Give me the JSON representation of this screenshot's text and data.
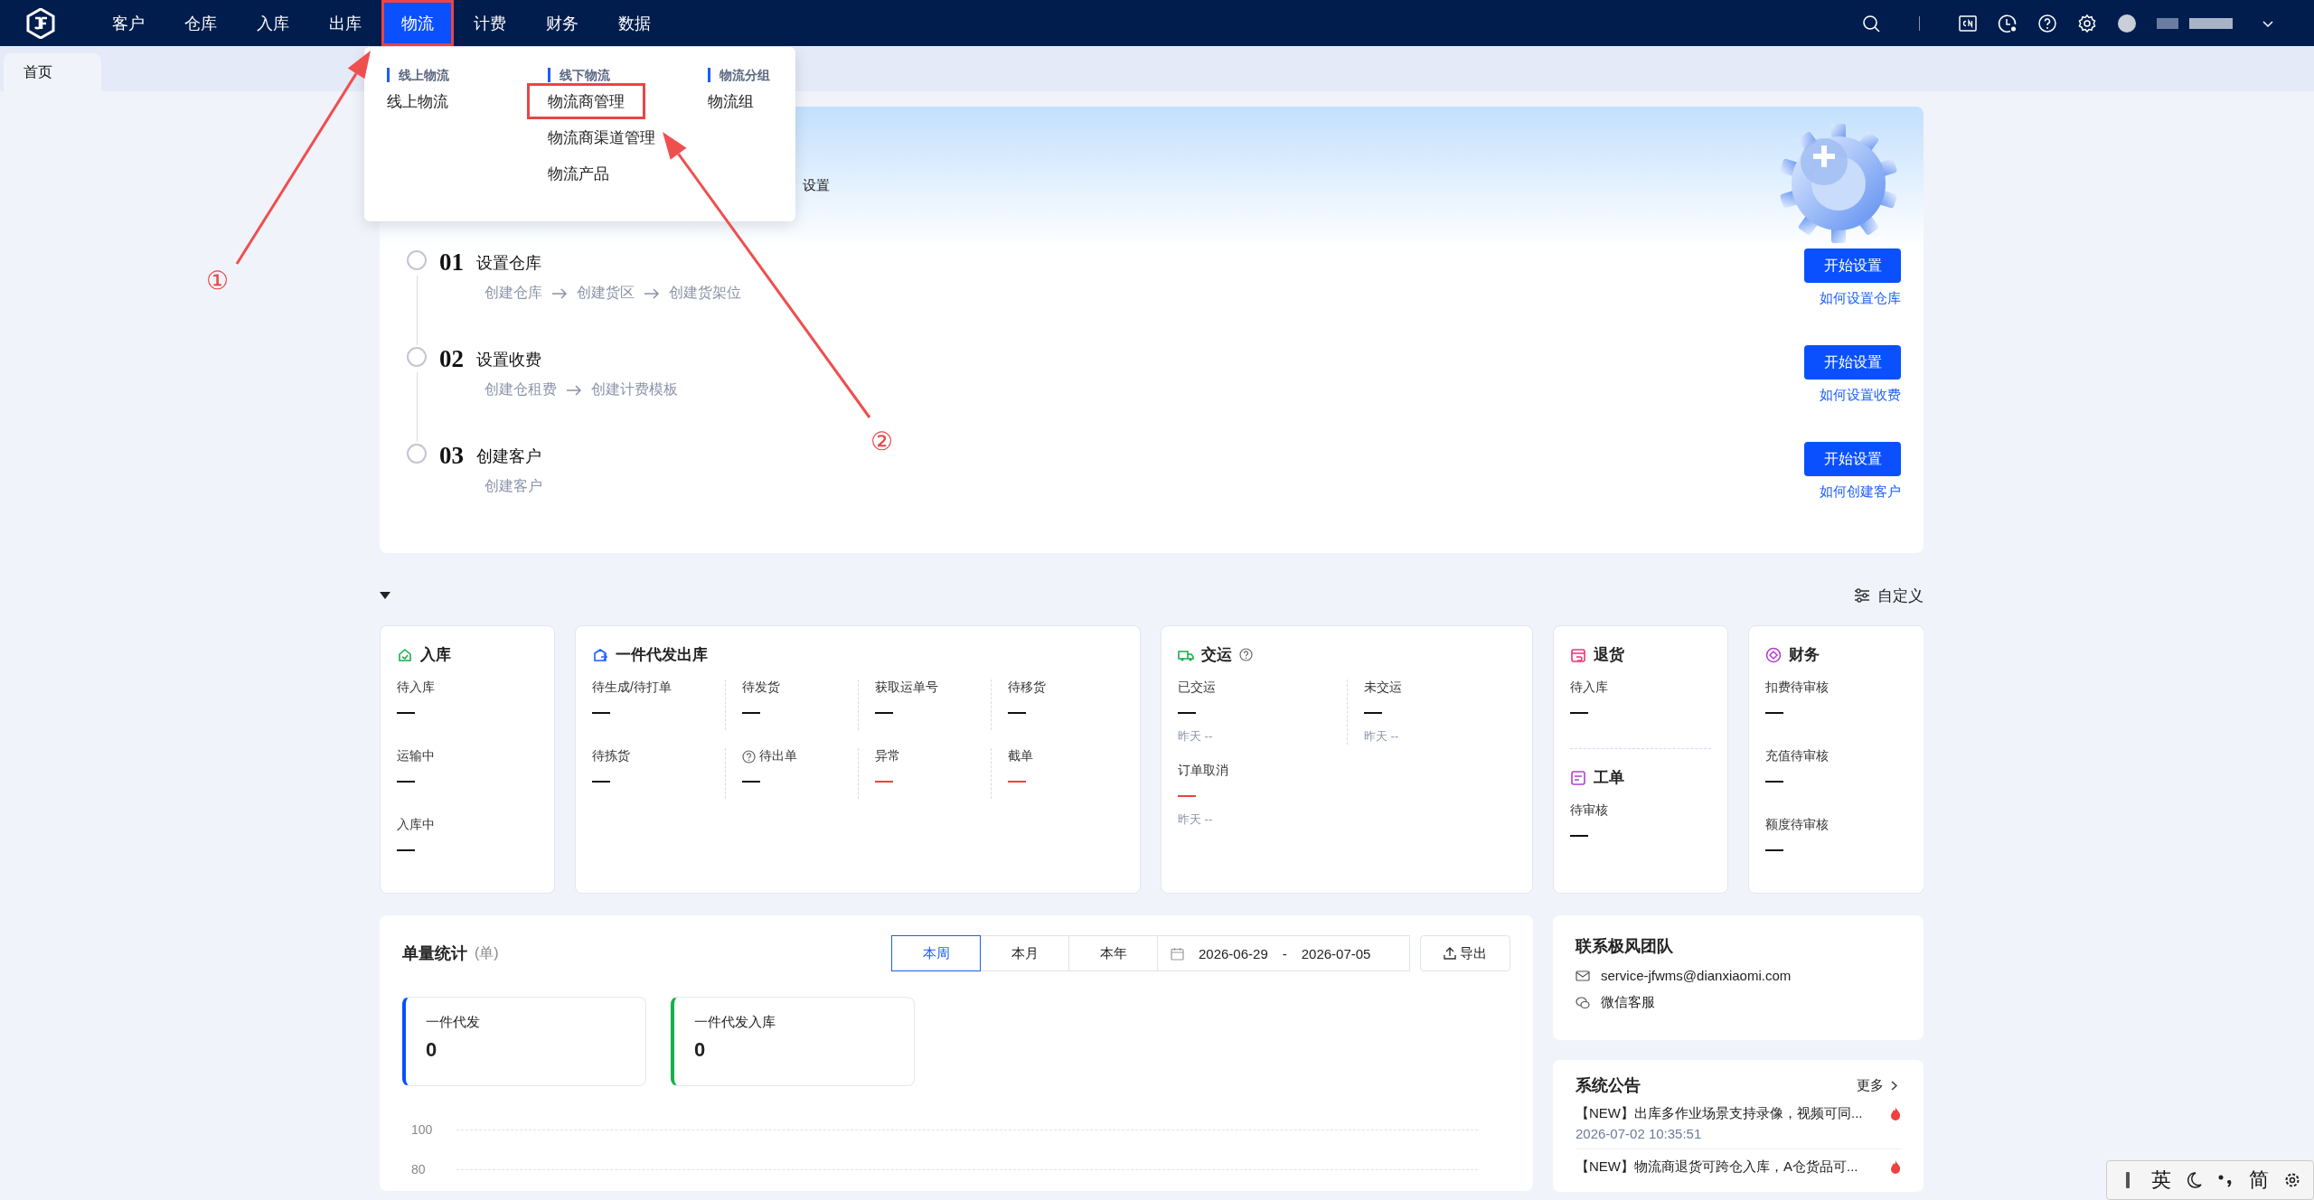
{
  "nav": {
    "items": [
      {
        "label": "客户",
        "selected": false,
        "annotated": false
      },
      {
        "label": "仓库",
        "selected": false,
        "annotated": false
      },
      {
        "label": "入库",
        "selected": false,
        "annotated": false
      },
      {
        "label": "出库",
        "selected": false,
        "annotated": false
      },
      {
        "label": "物流",
        "selected": true,
        "annotated": true
      },
      {
        "label": "计费",
        "selected": false,
        "annotated": false
      },
      {
        "label": "财务",
        "selected": false,
        "annotated": false
      },
      {
        "label": "数据",
        "selected": false,
        "annotated": false
      }
    ]
  },
  "tabs": [
    {
      "label": "首页",
      "selected": true
    }
  ],
  "menu": {
    "groups": [
      {
        "title": "线上物流",
        "items": [
          {
            "label": "线上物流",
            "annotated": false
          }
        ]
      },
      {
        "title": "线下物流",
        "items": [
          {
            "label": "物流商管理",
            "annotated": true
          },
          {
            "label": "物流商渠道管理",
            "annotated": false
          },
          {
            "label": "物流产品",
            "annotated": false
          }
        ]
      },
      {
        "title": "物流分组",
        "items": [
          {
            "label": "物流组",
            "annotated": false
          }
        ]
      }
    ]
  },
  "annotations": [
    {
      "label": "①"
    },
    {
      "label": "②"
    }
  ],
  "setup": {
    "title_fragment": "设置",
    "steps": [
      {
        "number": "01",
        "done": false,
        "title": "设置仓库",
        "substeps": [
          "创建仓库",
          "创建货区",
          "创建货架位"
        ],
        "button": "开始设置",
        "help_link": "如何设置仓库"
      },
      {
        "number": "02",
        "done": false,
        "title": "设置收费",
        "substeps": [
          "创建仓租费",
          "创建计费模板"
        ],
        "button": "开始设置",
        "help_link": "如何设置收费"
      },
      {
        "number": "03",
        "done": false,
        "title": "创建客户",
        "substeps": [
          "创建客户"
        ],
        "button": "开始设置",
        "help_link": "如何创建客户"
      }
    ]
  },
  "overview": {
    "expanded": true,
    "customize": "自定义",
    "cards": [
      {
        "sections": [
          {
            "kind": "inbound",
            "title": "入库",
            "help": false,
            "metrics": [
              {
                "label": "待入库",
                "value": "—",
                "alert": false
              },
              {
                "label": "运输中",
                "value": "—",
                "alert": false
              },
              {
                "label": "入库中",
                "value": "—",
                "alert": false
              }
            ]
          }
        ]
      },
      {
        "sections": [
          {
            "kind": "outbound",
            "title": "一件代发出库",
            "help": false,
            "metrics": [
              {
                "label": "待生成/待打单",
                "value": "—",
                "alert": false,
                "help": false
              },
              {
                "label": "待发货",
                "value": "—",
                "alert": false,
                "help": false
              },
              {
                "label": "获取运单号",
                "value": "—",
                "alert": false,
                "help": false
              },
              {
                "label": "待移货",
                "value": "—",
                "alert": false,
                "help": false
              },
              {
                "label": "待拣货",
                "value": "—",
                "alert": false,
                "help": false
              },
              {
                "label": "待出单",
                "value": "—",
                "alert": false,
                "help": true
              },
              {
                "label": "异常",
                "value": "—",
                "alert": true,
                "help": false
              },
              {
                "label": "截单",
                "value": "—",
                "alert": true,
                "help": false
              }
            ]
          }
        ]
      },
      {
        "sections": [
          {
            "kind": "handover",
            "title": "交运",
            "help": true,
            "metrics": [
              {
                "label": "已交运",
                "value": "—",
                "alert": false,
                "note": "昨天 --"
              },
              {
                "label": "未交运",
                "value": "—",
                "alert": false,
                "note": "昨天 --"
              },
              {
                "label": "订单取消",
                "value": "—",
                "alert": true,
                "note": "昨天 --"
              }
            ]
          }
        ]
      },
      {
        "sections": [
          {
            "kind": "returns",
            "title": "退货",
            "help": false,
            "metrics": [
              {
                "label": "待入库",
                "value": "—",
                "alert": false
              }
            ]
          },
          {
            "kind": "tickets",
            "title": "工单",
            "help": false,
            "metrics": [
              {
                "label": "待审核",
                "value": "—",
                "alert": false
              }
            ]
          }
        ]
      },
      {
        "sections": [
          {
            "kind": "finance",
            "title": "财务",
            "help": false,
            "metrics": [
              {
                "label": "扣费待审核",
                "value": "—",
                "alert": false
              },
              {
                "label": "充值待审核",
                "value": "—",
                "alert": false
              },
              {
                "label": "额度待审核",
                "value": "—",
                "alert": false
              }
            ]
          }
        ]
      }
    ]
  },
  "stats": {
    "title": "单量统计",
    "unit": "(单)",
    "periods": [
      {
        "label": "本周",
        "selected": true
      },
      {
        "label": "本月",
        "selected": false
      },
      {
        "label": "本年",
        "selected": false
      }
    ],
    "date_from": "2026-06-29",
    "date_separator": "-",
    "date_to": "2026-07-05",
    "export": "导出",
    "tiles": [
      {
        "label": "一件代发",
        "value": "0",
        "color": "#0052ff"
      },
      {
        "label": "一件代发入库",
        "value": "0",
        "color": "#16b04a"
      }
    ],
    "y_labels": [
      "100",
      "80"
    ]
  },
  "contact": {
    "title": "联系极风团队",
    "email": "service-jfwms@dianxiaomi.com",
    "wechat": "微信客服"
  },
  "notices": {
    "title": "系统公告",
    "more": "更多",
    "items": [
      {
        "text": "【NEW】出库多作业场景支持录像，视频可同...",
        "date": "2026-07-02 10:35:51",
        "hot": true
      },
      {
        "text": "【NEW】物流商退货可跨仓入库，A仓货品可...",
        "hot": true
      }
    ]
  },
  "ime": {
    "mode": "英",
    "script": "简"
  }
}
